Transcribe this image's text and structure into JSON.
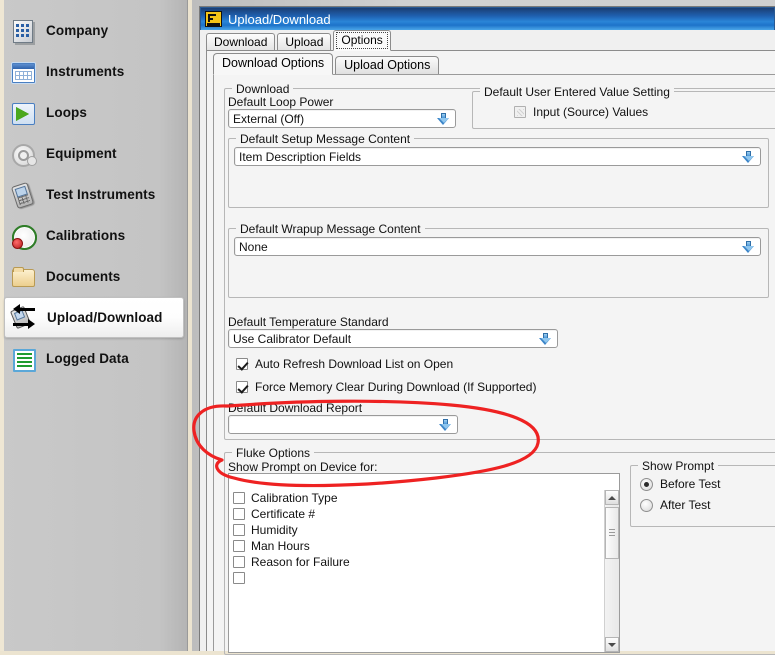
{
  "sidebar": {
    "items": [
      {
        "label": "Company",
        "icon": "building-icon"
      },
      {
        "label": "Instruments",
        "icon": "calendar-icon"
      },
      {
        "label": "Loops",
        "icon": "loops-icon"
      },
      {
        "label": "Equipment",
        "icon": "equipment-icon"
      },
      {
        "label": "Test Instruments",
        "icon": "test-instrument-icon"
      },
      {
        "label": "Calibrations",
        "icon": "gauge-icon"
      },
      {
        "label": "Documents",
        "icon": "folder-icon"
      },
      {
        "label": "Upload/Download",
        "icon": "upload-download-icon"
      },
      {
        "label": "Logged Data",
        "icon": "logged-data-icon"
      }
    ],
    "selected_index": 7
  },
  "window": {
    "title": "Upload/Download",
    "icon": "fluke-f-icon",
    "titlebar_color": "#1f5fae"
  },
  "tabs": [
    {
      "label": "Download",
      "active": false
    },
    {
      "label": "Upload",
      "active": false
    },
    {
      "label": "Options",
      "active": true
    }
  ],
  "subtabs": [
    {
      "label": "Download Options",
      "active": true
    },
    {
      "label": "Upload Options",
      "active": false
    }
  ],
  "download_group": {
    "legend": "Download",
    "loop_power": {
      "label": "Default Loop Power",
      "value": "External (Off)"
    },
    "user_entered": {
      "legend": "Default User Entered Value Setting",
      "checkbox": {
        "label": "Input (Source) Values",
        "checked": false,
        "disabled": true
      }
    },
    "setup_message": {
      "legend": "Default Setup Message Content",
      "value": "Item Description Fields"
    },
    "wrapup_message": {
      "legend": "Default Wrapup Message Content",
      "value": "None"
    },
    "temperature_standard": {
      "label": "Default Temperature Standard",
      "value": "Use Calibrator Default"
    },
    "checkboxes": [
      {
        "label": "Auto Refresh Download List on Open",
        "checked": true
      },
      {
        "label": "Force Memory Clear During Download (If Supported)",
        "checked": true
      }
    ],
    "download_report": {
      "label": "Default Download Report",
      "value": ""
    }
  },
  "fluke_options": {
    "legend": "Fluke Options",
    "list_header": "Show Prompt on Device for:",
    "items": [
      {
        "label": "Calibration Type",
        "checked": false
      },
      {
        "label": "Certificate #",
        "checked": false
      },
      {
        "label": "Humidity",
        "checked": false
      },
      {
        "label": "Man Hours",
        "checked": false
      },
      {
        "label": "Reason for Failure",
        "checked": false
      }
    ],
    "show_prompt": {
      "legend": "Show Prompt",
      "options": [
        {
          "label": "Before Test",
          "selected": true
        },
        {
          "label": "After Test",
          "selected": false
        }
      ]
    }
  },
  "annotation": {
    "color": "#ee2222",
    "shape": "hand-drawn-ellipse"
  }
}
